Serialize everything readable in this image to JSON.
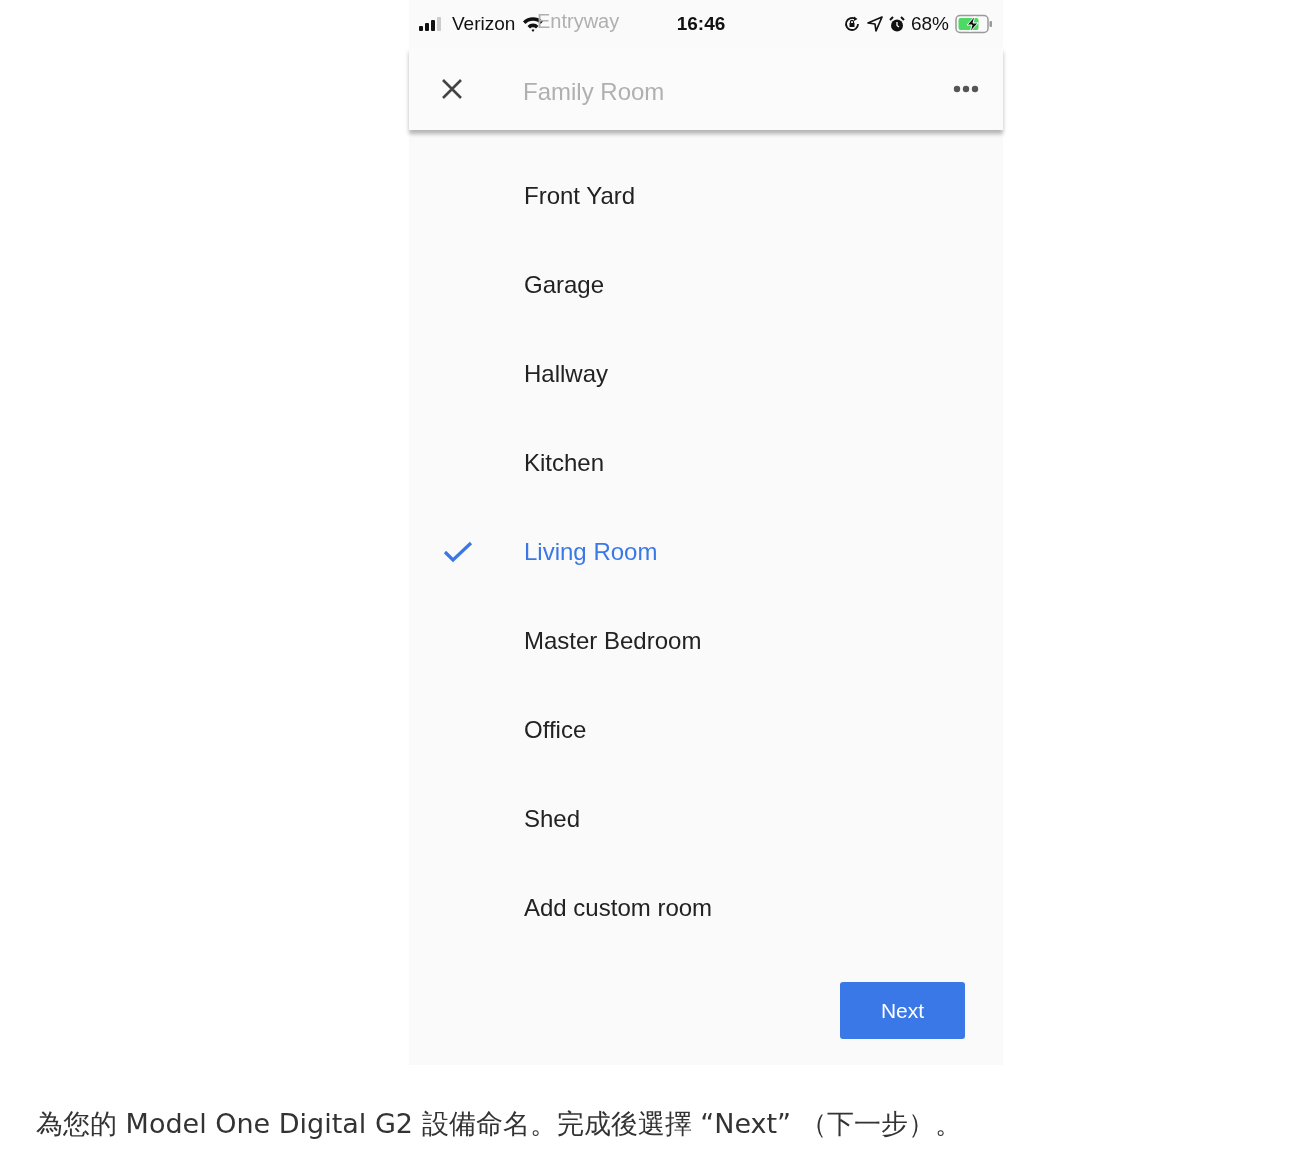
{
  "status_bar": {
    "carrier": "Verizon",
    "time": "16:46",
    "battery_percent": "68%"
  },
  "scrolled_under": [
    "Entryway",
    "Family Room"
  ],
  "rooms": [
    {
      "label": "Front Yard",
      "selected": false
    },
    {
      "label": "Garage",
      "selected": false
    },
    {
      "label": "Hallway",
      "selected": false
    },
    {
      "label": "Kitchen",
      "selected": false
    },
    {
      "label": "Living Room",
      "selected": true
    },
    {
      "label": "Master Bedroom",
      "selected": false
    },
    {
      "label": "Office",
      "selected": false
    },
    {
      "label": "Shed",
      "selected": false
    },
    {
      "label": "Add custom room",
      "selected": false
    }
  ],
  "next_button": "Next",
  "caption": "為您的 Model One Digital G2 設備命名。完成後選擇 “Next” （下一步）。"
}
